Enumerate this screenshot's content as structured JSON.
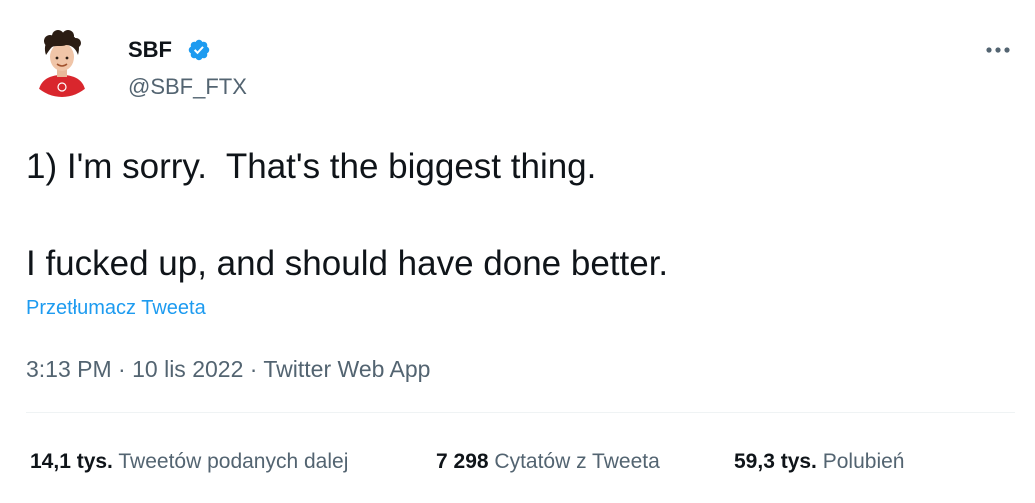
{
  "author": {
    "name": "SBF",
    "handle": "@SBF_FTX",
    "verified_color": "#1d9bf0"
  },
  "tweet": {
    "lines": [
      "1) I'm sorry.  That's the biggest thing.",
      "I fucked up, and should have done better."
    ],
    "translate_label": "Przetłumacz Tweeta"
  },
  "meta": {
    "time": "3:13 PM",
    "separator": "·",
    "date": "10 lis 2022",
    "source": "Twitter Web App"
  },
  "stats": {
    "retweets": {
      "value": "14,1 tys.",
      "label": "Tweetów podanych dalej"
    },
    "quotes": {
      "value": "7 298",
      "label": "Cytatów z Tweeta"
    },
    "likes": {
      "value": "59,3 tys.",
      "label": "Polubień"
    }
  },
  "icons": {
    "more": "more-horizontal-icon",
    "verified": "verified-badge-icon"
  },
  "colors": {
    "text_primary": "#0f1419",
    "text_secondary": "#536471",
    "link": "#1d9bf0",
    "divider": "#eff3f4",
    "avatar_shirt": "#d9262d"
  }
}
